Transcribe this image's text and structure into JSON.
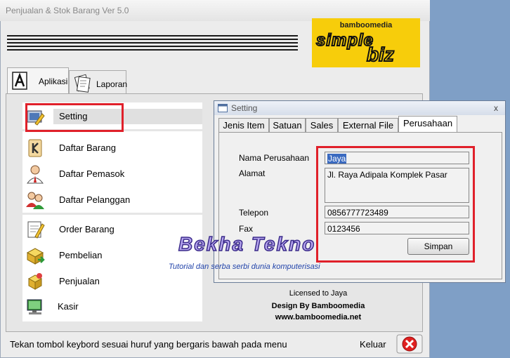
{
  "window": {
    "title": "Penjualan & Stok Barang Ver 5.0"
  },
  "logo": {
    "brand": "bamboomedia",
    "simple": "simple",
    "biz": "biz"
  },
  "tabs": [
    {
      "label": "Aplikasi"
    },
    {
      "label": "Laporan"
    }
  ],
  "menu": [
    {
      "label": "Setting"
    },
    {
      "label": "Daftar Barang"
    },
    {
      "label": "Daftar Pemasok"
    },
    {
      "label": "Daftar Pelanggan"
    },
    {
      "label": "Order Barang"
    },
    {
      "label": "Pembelian"
    },
    {
      "label": "Penjualan"
    },
    {
      "label": "Kasir"
    }
  ],
  "footer": {
    "licensed": "Licensed to Jaya",
    "design": "Design By Bamboomedia",
    "website": "www.bamboomedia.net",
    "status": "Tekan tombol keybord sesuai huruf yang bergaris bawah pada menu",
    "exit_label": "Keluar"
  },
  "dialog": {
    "title": "Setting",
    "close": "x",
    "tabs": [
      {
        "label": "Jenis Item"
      },
      {
        "label": "Satuan"
      },
      {
        "label": "Sales"
      },
      {
        "label": "External File"
      },
      {
        "label": "Perusahaan"
      }
    ],
    "fields": {
      "nama_label": "Nama Perusahaan",
      "nama_value": "Jaya",
      "alamat_label": "Alamat",
      "alamat_value": "Jl. Raya Adipala Komplek Pasar",
      "telepon_label": "Telepon",
      "telepon_value": "0856777723489",
      "fax_label": "Fax",
      "fax_value": "0123456"
    },
    "save_label": "Simpan"
  },
  "watermark": {
    "title": "Bekha Tekno",
    "subtitle": "Tutorial dan serba serbi dunia komputerisasi"
  },
  "colors": {
    "highlight_box": "#e0202a",
    "logo_bg": "#f7cd0b",
    "desktop": "#7f9fc6"
  }
}
